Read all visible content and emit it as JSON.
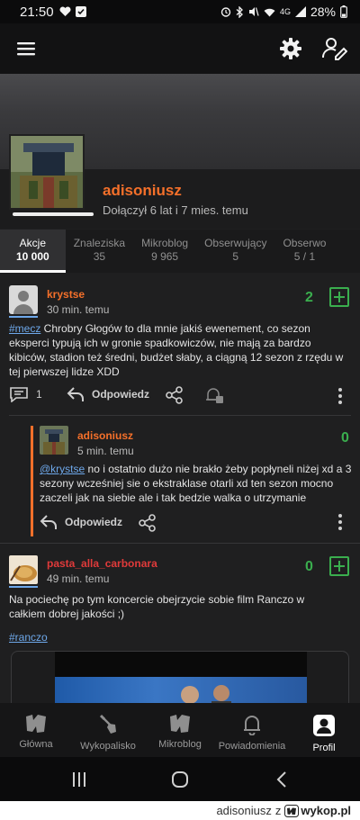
{
  "status": {
    "time": "21:50",
    "battery": "28%",
    "network": "4G"
  },
  "profile": {
    "username": "adisoniusz",
    "joined": "Dołączył 6 lat i 7 mies. temu"
  },
  "tabs": [
    {
      "label": "Akcje",
      "count": "10 000",
      "active": true
    },
    {
      "label": "Znaleziska",
      "count": "35"
    },
    {
      "label": "Mikroblog",
      "count": "9 965"
    },
    {
      "label": "Obserwujący",
      "count": "5"
    },
    {
      "label": "Obserwo",
      "count": "5 / 1"
    }
  ],
  "posts": [
    {
      "author": "krystse",
      "time": "30 min. temu",
      "votes": "2",
      "tag": "#mecz",
      "body": " Chrobry Głogów to dla mnie jakiś ewenement, co sezon eksperci typują ich w gronie spadkowiczów, nie mają za bardzo kibiców, stadion też średni, budżet słaby, a ciągną 12 sezon z rzędu w tej pierwszej lidze XDD",
      "comments": "1",
      "reply_label": "Odpowiedz"
    },
    {
      "author": "adisoniusz",
      "time": "5 min. temu",
      "votes": "0",
      "mention": "@krystse",
      "body": " no i ostatnio dużo nie brakło żeby popłyneli niżej xd a 3 sezony wcześniej sie o ekstraklase otarli xd ten sezon mocno zaczeli jak na siebie ale i tak bedzie walka o utrzymanie",
      "reply_label": "Odpowiedz"
    },
    {
      "author": "pasta_alla_carbonara",
      "time": "49 min. temu",
      "votes": "0",
      "body": "Na pociechę po tym koncercie obejrzycie sobie film Ranczo w całkiem dobrej jakości ;)",
      "tag": "#ranczo"
    }
  ],
  "bottom_nav": [
    {
      "label": "Główna",
      "icon": "wykop-logo-icon"
    },
    {
      "label": "Wykopalisko",
      "icon": "shovel-icon"
    },
    {
      "label": "Mikroblog",
      "icon": "mikroblog-logo-icon"
    },
    {
      "label": "Powiadomienia",
      "icon": "bell-icon"
    },
    {
      "label": "Profil",
      "icon": "profile-icon",
      "active": true
    }
  ],
  "footer": {
    "author": "adisoniusz",
    "connector": "z",
    "brand": "wykop.pl"
  },
  "colors": {
    "accent": "#f5702a",
    "vote": "#3aae4e",
    "link": "#6ea8ea",
    "background": "#1f1f20"
  }
}
